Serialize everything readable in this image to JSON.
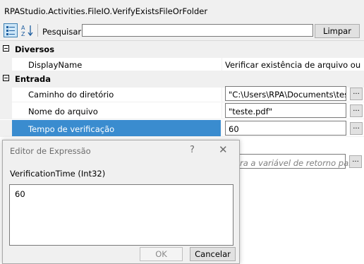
{
  "window": {
    "title": "RPAStudio.Activities.FileIO.VerifyExistsFileOrFolder"
  },
  "toolbar": {
    "search_label": "Pesquisar:",
    "search_value": "",
    "clear_label": "Limpar"
  },
  "categories": [
    {
      "label": "Diversos",
      "properties": [
        {
          "name": "DisplayName",
          "value": "Verificar existência de arquivo ou dire"
        }
      ]
    },
    {
      "label": "Entrada",
      "properties": [
        {
          "name": "Caminho do diretório",
          "value": "\"C:\\Users\\RPA\\Documents\\teste\""
        },
        {
          "name": "Nome do arquivo",
          "value": "\"teste.pdf\""
        },
        {
          "name": "Tempo de verificação",
          "value": "60",
          "selected": true
        }
      ]
    }
  ],
  "hidden_row": {
    "placeholder": "ra a variável de retorno para"
  },
  "dialog": {
    "title": "Editor de Expressão",
    "help_glyph": "?",
    "close_glyph": "✕",
    "variable_label": "VerificationTime (Int32)",
    "expression_value": "60",
    "ok_label": "OK",
    "cancel_label": "Cancelar"
  },
  "ellipsis": "...",
  "colors": {
    "selection": "#3a8ccf",
    "panel": "#f0f0f0"
  }
}
